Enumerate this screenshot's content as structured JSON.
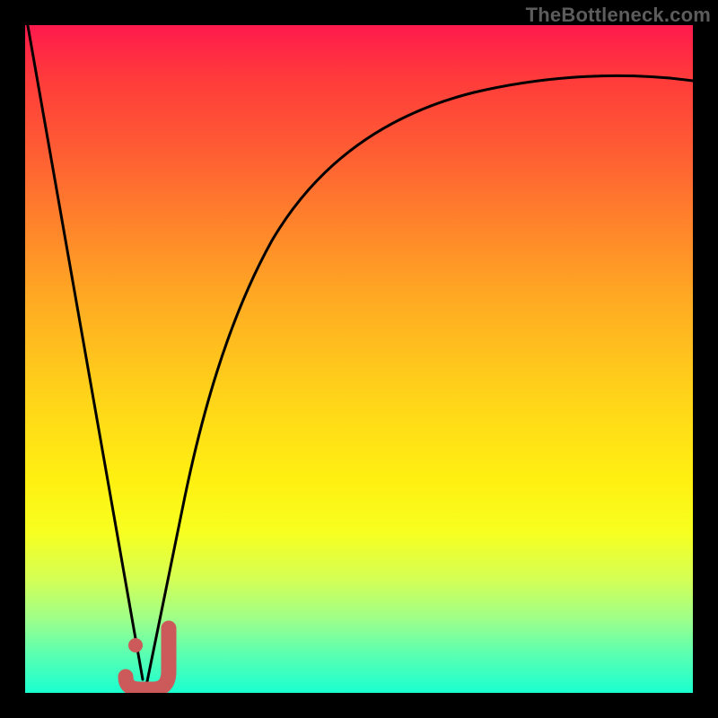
{
  "attribution": "TheBottleneck.com",
  "colors": {
    "frame": "#000000",
    "curve": "#000000",
    "marker_fill": "#cc5a5a",
    "marker_stroke": "#b84848"
  },
  "chart_data": {
    "type": "line",
    "title": "",
    "xlabel": "",
    "ylabel": "",
    "xlim": [
      0,
      100
    ],
    "ylim": [
      0,
      100
    ],
    "series": [
      {
        "name": "left-segment",
        "x": [
          0,
          17.5
        ],
        "y": [
          100,
          2
        ]
      },
      {
        "name": "right-curve",
        "x": [
          18,
          20,
          22,
          25,
          28,
          32,
          36,
          40,
          45,
          50,
          56,
          63,
          71,
          80,
          90,
          100
        ],
        "y": [
          1,
          3,
          9,
          19,
          30,
          42,
          52,
          60,
          67,
          73,
          78,
          82,
          85.5,
          88,
          90,
          91.5
        ]
      }
    ],
    "marker": {
      "name": "j-shape",
      "approx_center_x": 19,
      "approx_center_y": 4,
      "dot_x": 16.5,
      "dot_y": 7
    },
    "gradient_stops": [
      {
        "pos": 0.0,
        "color": "#ff1a4d"
      },
      {
        "pos": 0.3,
        "color": "#ff842b"
      },
      {
        "pos": 0.55,
        "color": "#ffd21a"
      },
      {
        "pos": 0.76,
        "color": "#f7ff20"
      },
      {
        "pos": 1.0,
        "color": "#1affd0"
      }
    ]
  }
}
